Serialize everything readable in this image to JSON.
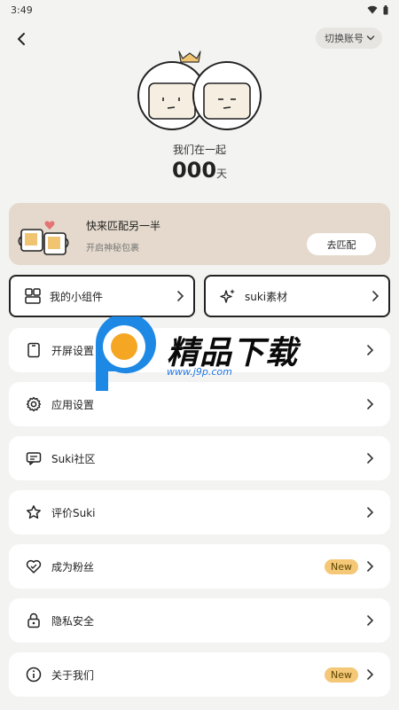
{
  "status": {
    "time": "3:49"
  },
  "header": {
    "switch_account": "切换账号"
  },
  "couple": {
    "label": "我们在一起",
    "days": "000",
    "days_unit": "天"
  },
  "match": {
    "title": "快来匹配另一半",
    "subtitle": "开启神秘包裹",
    "button": "去匹配"
  },
  "widgets": [
    {
      "label": "我的小组件",
      "icon": "widget-grid-icon"
    },
    {
      "label": "suki素材",
      "icon": "sparkle-icon"
    }
  ],
  "menu": [
    {
      "label": "开屏设置",
      "icon": "phone-screen-icon"
    },
    {
      "label": "应用设置",
      "icon": "gear-icon"
    },
    {
      "label": "Suki社区",
      "icon": "chat-bubble-icon"
    },
    {
      "label": "评价Suki",
      "icon": "star-icon"
    },
    {
      "label": "成为粉丝",
      "icon": "heart-icon",
      "badge": "New"
    },
    {
      "label": "隐私安全",
      "icon": "lock-icon"
    },
    {
      "label": "关于我们",
      "icon": "info-icon",
      "badge": "New"
    }
  ],
  "watermark": {
    "text": "精品下载",
    "url": "www.j9p.com"
  },
  "colors": {
    "match_bg": "#e4d9cc",
    "badge": "#f4c877",
    "page_bg": "#f3f3f1"
  }
}
